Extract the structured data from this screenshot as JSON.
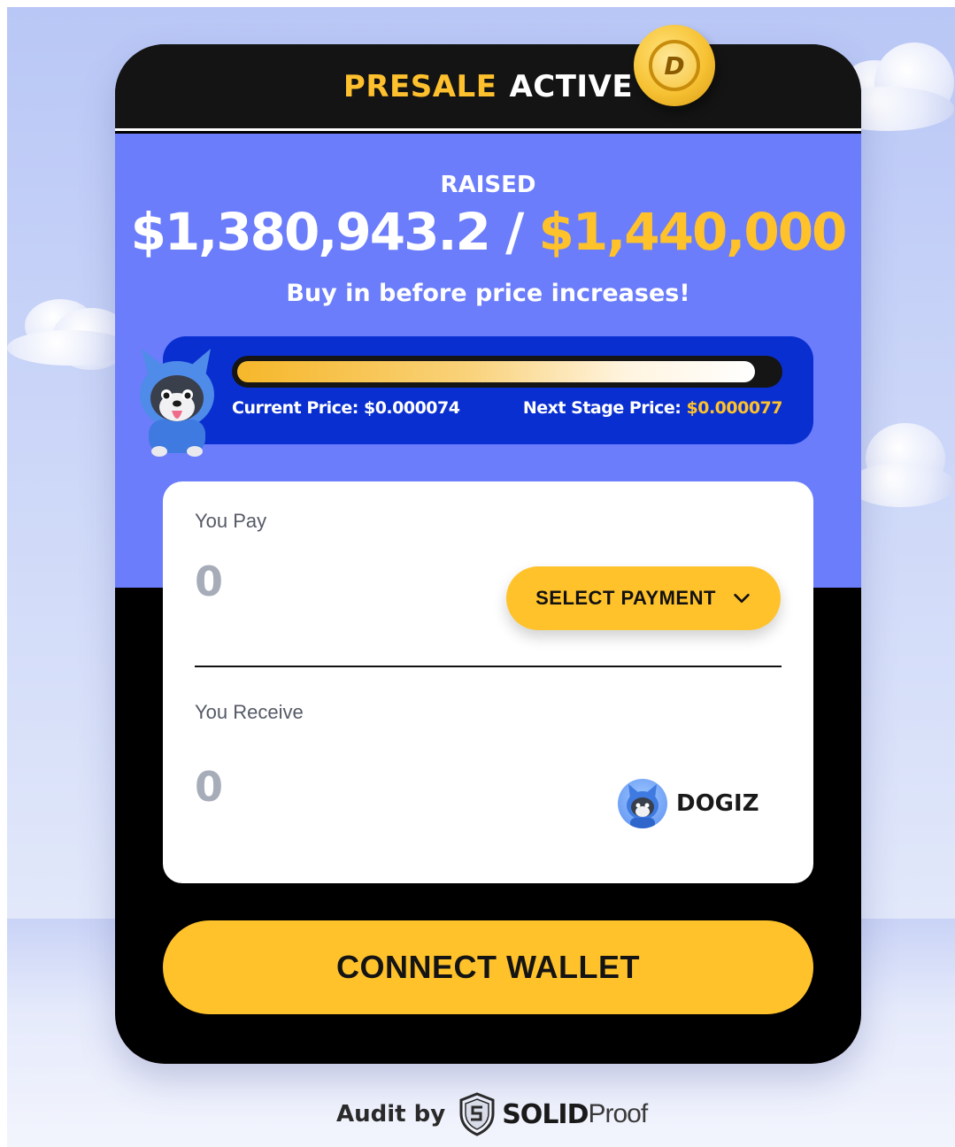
{
  "header": {
    "title_part1": "PRESALE",
    "title_part2": "ACTIVE",
    "coin_letter": "D"
  },
  "raised": {
    "label": "RAISED",
    "current": "$1,380,943.2",
    "separator": "/",
    "goal": "$1,440,000",
    "note": "Buy in before price increases!"
  },
  "progress": {
    "fraction": 0.959,
    "current_price_label": "Current Price: $0.000074",
    "next_price_label": "Next Stage Price:",
    "next_price_value": "$0.000077"
  },
  "form": {
    "pay_label": "You Pay",
    "pay_value": "0",
    "select_payment_label": "SELECT PAYMENT",
    "receive_label": "You Receive",
    "receive_value": "0",
    "token_name": "DOGIZ"
  },
  "connect_button": "CONNECT WALLET",
  "audit": {
    "prefix": "Audit by",
    "brand_bold": "SOLID",
    "brand_light": "Proof"
  },
  "colors": {
    "accent_yellow": "#ffc22b",
    "panel_blue": "#6b7dfb",
    "progress_panel_blue": "#0a2fd0",
    "card_black": "#000000"
  },
  "icons": {
    "coin": "dogiz-coin-icon",
    "mascot": "dog-mascot-icon",
    "chevron": "chevron-down-icon",
    "token": "dogiz-token-icon",
    "audit": "solidproof-shield-icon"
  }
}
